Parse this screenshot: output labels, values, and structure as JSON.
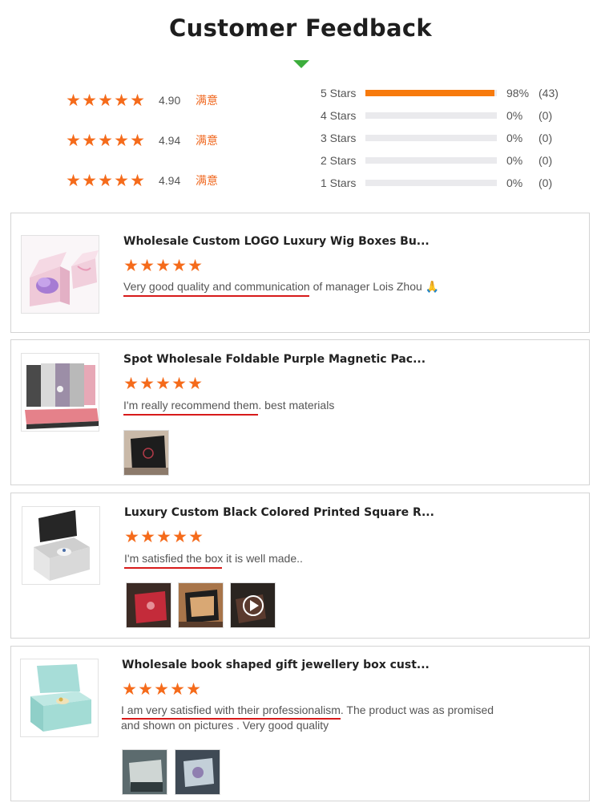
{
  "header": {
    "title": "Customer Feedback"
  },
  "summary": [
    {
      "value": "4.90",
      "label": "满意"
    },
    {
      "value": "4.94",
      "label": "满意"
    },
    {
      "value": "4.94",
      "label": "满意"
    }
  ],
  "distribution": [
    {
      "label": "5 Stars",
      "fill": 0.98,
      "percent": "98%",
      "count": "(43)"
    },
    {
      "label": "4 Stars",
      "fill": 0,
      "percent": "0%",
      "count": "(0)"
    },
    {
      "label": "3 Stars",
      "fill": 0,
      "percent": "0%",
      "count": "(0)"
    },
    {
      "label": "2 Stars",
      "fill": 0,
      "percent": "0%",
      "count": "(0)"
    },
    {
      "label": "1 Stars",
      "fill": 0,
      "percent": "0%",
      "count": "(0)"
    }
  ],
  "reviews": [
    {
      "title": "Wholesale Custom LOGO Luxury Wig Boxes Bu...",
      "stars": 5,
      "text_highlight": "Very good quality and communication",
      "text_rest": " of manager Lois Zhou 🙏",
      "photos": 0
    },
    {
      "title": "Spot Wholesale Foldable Purple Magnetic Pac...",
      "stars": 5,
      "text_highlight": "I'm really recommend them.",
      "text_rest": " best materials",
      "photos": 1
    },
    {
      "title": "Luxury Custom Black Colored Printed Square R...",
      "stars": 5,
      "text_highlight": "I'm satisfied the box",
      "text_rest": " it is well made..",
      "photos": 3
    },
    {
      "title": "Wholesale book shaped gift jewellery box cust...",
      "stars": 5,
      "text_highlight": "I am very satisfied with their professionalism",
      "text_rest": ". The product was as promised and shown on pictures . Very good quality",
      "photos": 2
    }
  ],
  "colors": {
    "star": "#f56b1b",
    "bar": "#f77a0c",
    "underline": "#d71a1a",
    "accent_triangle": "#3cad3c",
    "satisfied_label": "#f06a22"
  }
}
